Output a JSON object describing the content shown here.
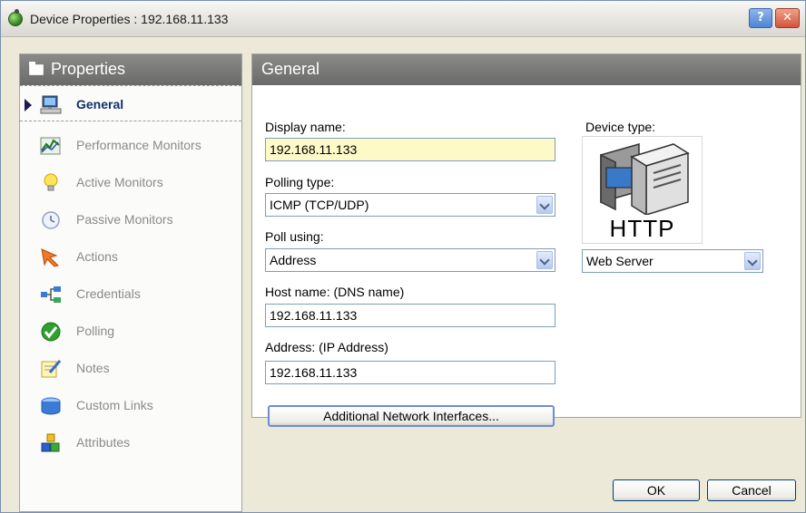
{
  "window": {
    "title": "Device Properties : 192.168.11.133"
  },
  "titlebar": {
    "help_label": "?",
    "close_label": "✕"
  },
  "sidebar": {
    "header": "Properties",
    "items": [
      {
        "label": "General",
        "icon": "computer-icon",
        "selected": true
      },
      {
        "label": "Performance Monitors",
        "icon": "chart-icon",
        "selected": false
      },
      {
        "label": "Active Monitors",
        "icon": "lightbulb-icon",
        "selected": false
      },
      {
        "label": "Passive Monitors",
        "icon": "clock-icon",
        "selected": false
      },
      {
        "label": "Actions",
        "icon": "actions-icon",
        "selected": false
      },
      {
        "label": "Credentials",
        "icon": "network-icon",
        "selected": false
      },
      {
        "label": "Polling",
        "icon": "checkmark-icon",
        "selected": false
      },
      {
        "label": "Notes",
        "icon": "notes-icon",
        "selected": false
      },
      {
        "label": "Custom Links",
        "icon": "links-icon",
        "selected": false
      },
      {
        "label": "Attributes",
        "icon": "blocks-icon",
        "selected": false
      }
    ]
  },
  "main": {
    "header": "General",
    "display_name": {
      "label": "Display name:",
      "value": "192.168.11.133"
    },
    "polling_type": {
      "label": "Polling type:",
      "value": "ICMP (TCP/UDP)"
    },
    "poll_using": {
      "label": "Poll using:",
      "value": "Address"
    },
    "host_name": {
      "label": "Host name: (DNS name)",
      "value": "192.168.11.133"
    },
    "address": {
      "label": "Address: (IP Address)",
      "value": "192.168.11.133"
    },
    "additional_button": "Additional Network Interfaces...",
    "device_type": {
      "label": "Device type:",
      "image_text": "HTTP",
      "value": "Web Server"
    }
  },
  "footer": {
    "ok_label": "OK",
    "cancel_label": "Cancel"
  },
  "colors": {
    "header_bg": "#7a7a78",
    "selected_text": "#10306a",
    "highlight_input": "#fdfac8",
    "dialog_bg": "#ece9d8"
  }
}
